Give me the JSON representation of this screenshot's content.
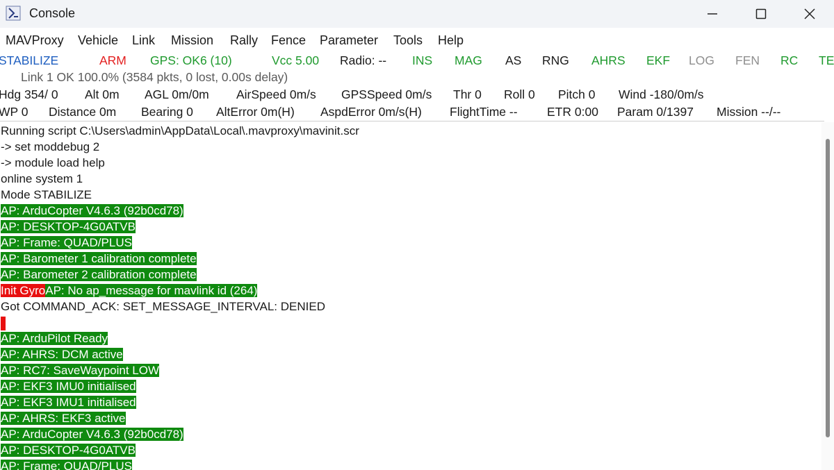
{
  "window": {
    "title": "Console"
  },
  "menu": [
    "MAVProxy",
    "Vehicle",
    "Link",
    "Mission",
    "Rally",
    "Fence",
    "Parameter",
    "Tools",
    "Help"
  ],
  "status1": [
    {
      "text": "STABILIZE",
      "color": "#1f5fc0"
    },
    {
      "text": "ARM",
      "color": "#e32020"
    },
    {
      "text": "GPS: OK6 (10)",
      "color": "#1f9a2e"
    },
    {
      "text": "Vcc 5.00",
      "color": "#1f9a2e"
    },
    {
      "text": "Radio: --",
      "color": "#1a1a1a"
    },
    {
      "text": "INS",
      "color": "#1f9a2e"
    },
    {
      "text": "MAG",
      "color": "#1f9a2e"
    },
    {
      "text": "AS",
      "color": "#1a1a1a"
    },
    {
      "text": "RNG",
      "color": "#1a1a1a"
    },
    {
      "text": "AHRS",
      "color": "#1f9a2e"
    },
    {
      "text": "EKF",
      "color": "#1f9a2e"
    },
    {
      "text": "LOG",
      "color": "#8f8f8f"
    },
    {
      "text": "FEN",
      "color": "#8f8f8f"
    },
    {
      "text": "RC",
      "color": "#1f9a2e"
    },
    {
      "text": "TE",
      "color": "#1f9a2e"
    }
  ],
  "link_status": "Link 1 OK 100.0% (3584 pkts, 0 lost, 0.00s delay)",
  "status3": [
    "Hdg 354/  0",
    "Alt 0m",
    "AGL 0m/0m",
    "AirSpeed 0m/s",
    "GPSSpeed 0m/s",
    "Thr 0",
    "Roll 0",
    "Pitch 0",
    "Wind -180/0m/s"
  ],
  "status4": [
    "WP 0",
    "Distance 0m",
    "Bearing 0",
    "AltError 0m(H)",
    "AspdError 0m/s(H)",
    "FlightTime --",
    "ETR 0:00",
    "Param 0/1397",
    "Mission --/--"
  ],
  "console_lines": [
    {
      "text": "Running script C:\\Users\\admin\\AppData\\Local\\.mavproxy\\mavinit.scr",
      "style": "plain"
    },
    {
      "text": "-> set moddebug 2",
      "style": "plain"
    },
    {
      "text": "-> module load help",
      "style": "plain"
    },
    {
      "text": "online system 1",
      "style": "plain"
    },
    {
      "text": "Mode STABILIZE",
      "style": "plain"
    },
    {
      "text": "AP: ArduCopter V4.6.3 (92b0cd78)",
      "style": "green"
    },
    {
      "text": "AP: DESKTOP-4G0ATVB",
      "style": "green"
    },
    {
      "text": "AP: Frame: QUAD/PLUS",
      "style": "green"
    },
    {
      "text": "AP: Barometer 1 calibration complete",
      "style": "green"
    },
    {
      "text": "AP: Barometer 2 calibration complete",
      "style": "green"
    },
    {
      "text": "Init Gyro",
      "style": "red",
      "rest": "AP: No ap_message for mavlink id (264)"
    },
    {
      "text": "Got COMMAND_ACK: SET_MESSAGE_INTERVAL: DENIED",
      "style": "plain"
    },
    {
      "text": "",
      "style": "redblock"
    },
    {
      "text": "AP: ArduPilot Ready",
      "style": "green"
    },
    {
      "text": "AP: AHRS: DCM active",
      "style": "green"
    },
    {
      "text": "AP: RC7: SaveWaypoint LOW",
      "style": "green"
    },
    {
      "text": "AP: EKF3 IMU0 initialised",
      "style": "green"
    },
    {
      "text": "AP: EKF3 IMU1 initialised",
      "style": "green"
    },
    {
      "text": "AP: AHRS: EKF3 active",
      "style": "green"
    },
    {
      "text": "AP: ArduCopter V4.6.3 (92b0cd78)",
      "style": "green"
    },
    {
      "text": "AP: DESKTOP-4G0ATVB",
      "style": "green"
    },
    {
      "text": "AP: Frame: QUAD/PLUS",
      "style": "green"
    }
  ]
}
